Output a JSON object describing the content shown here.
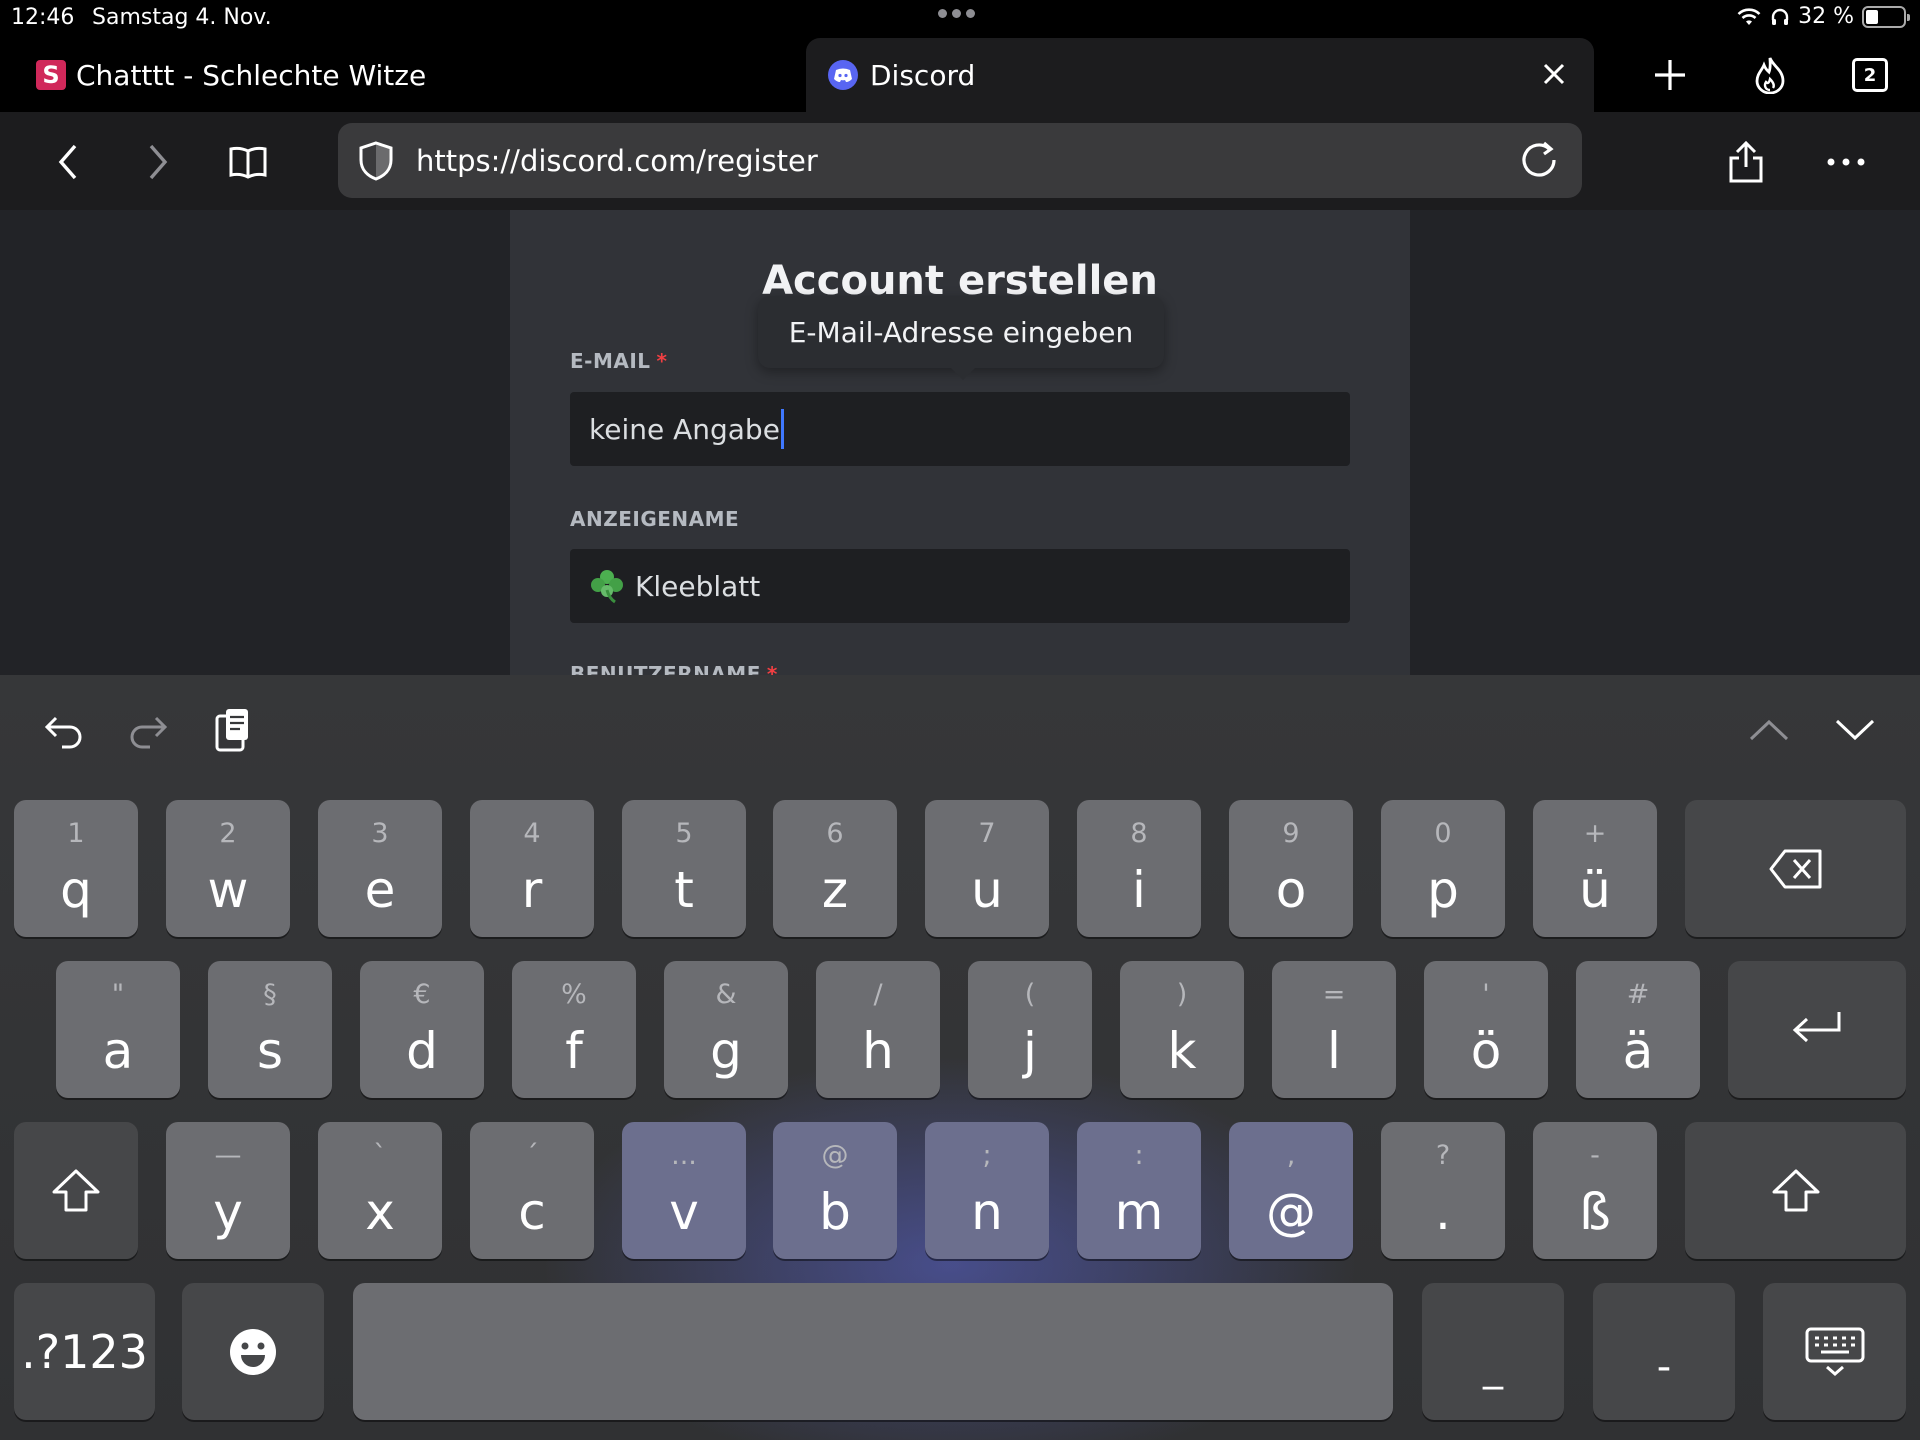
{
  "status_bar": {
    "time": "12:46",
    "date": "Samstag 4. Nov.",
    "battery": "32 %"
  },
  "tabs": [
    {
      "favicon": "S",
      "title": "Chatttt - Schlechte Witze",
      "active": false
    },
    {
      "favicon": "discord-icon",
      "title": "Discord",
      "active": true
    }
  ],
  "tab_count": "2",
  "url": "https://discord.com/register",
  "form": {
    "title": "Account erstellen",
    "tooltip": "E-Mail-Adresse eingeben",
    "email_label": "E-MAIL",
    "required_marker": "*",
    "email_value": "keine Angabe",
    "display_name_label": "ANZEIGENAME",
    "display_name_value": "Kleeblatt",
    "username_label": "BENUTZERNAME"
  },
  "keyboard": {
    "row1": [
      {
        "alt": "1",
        "main": "q"
      },
      {
        "alt": "2",
        "main": "w"
      },
      {
        "alt": "3",
        "main": "e"
      },
      {
        "alt": "4",
        "main": "r"
      },
      {
        "alt": "5",
        "main": "t"
      },
      {
        "alt": "6",
        "main": "z"
      },
      {
        "alt": "7",
        "main": "u"
      },
      {
        "alt": "8",
        "main": "i"
      },
      {
        "alt": "9",
        "main": "o"
      },
      {
        "alt": "0",
        "main": "p"
      },
      {
        "alt": "+",
        "main": "ü"
      }
    ],
    "row2": [
      {
        "alt": "\"",
        "main": "a"
      },
      {
        "alt": "§",
        "main": "s"
      },
      {
        "alt": "€",
        "main": "d"
      },
      {
        "alt": "%",
        "main": "f"
      },
      {
        "alt": "&",
        "main": "g"
      },
      {
        "alt": "/",
        "main": "h"
      },
      {
        "alt": "(",
        "main": "j"
      },
      {
        "alt": ")",
        "main": "k"
      },
      {
        "alt": "=",
        "main": "l"
      },
      {
        "alt": "'",
        "main": "ö"
      },
      {
        "alt": "#",
        "main": "ä"
      }
    ],
    "row3": [
      {
        "alt": "—",
        "main": "y"
      },
      {
        "alt": "`",
        "main": "x"
      },
      {
        "alt": "´",
        "main": "c"
      },
      {
        "alt": "...",
        "main": "v"
      },
      {
        "alt": "@",
        "main": "b"
      },
      {
        "alt": ";",
        "main": "n"
      },
      {
        "alt": ":",
        "main": "m"
      },
      {
        "alt": ",",
        "main": "@"
      },
      {
        "alt": "?",
        "main": "."
      },
      {
        "alt": "-",
        "main": "ß"
      }
    ],
    "numbers_key": ".?123",
    "underscore_key": "_",
    "dash_key": "-"
  },
  "colors": {
    "accent": "#5865f2",
    "required": "#f23f42",
    "caret": "#3f78ff"
  }
}
